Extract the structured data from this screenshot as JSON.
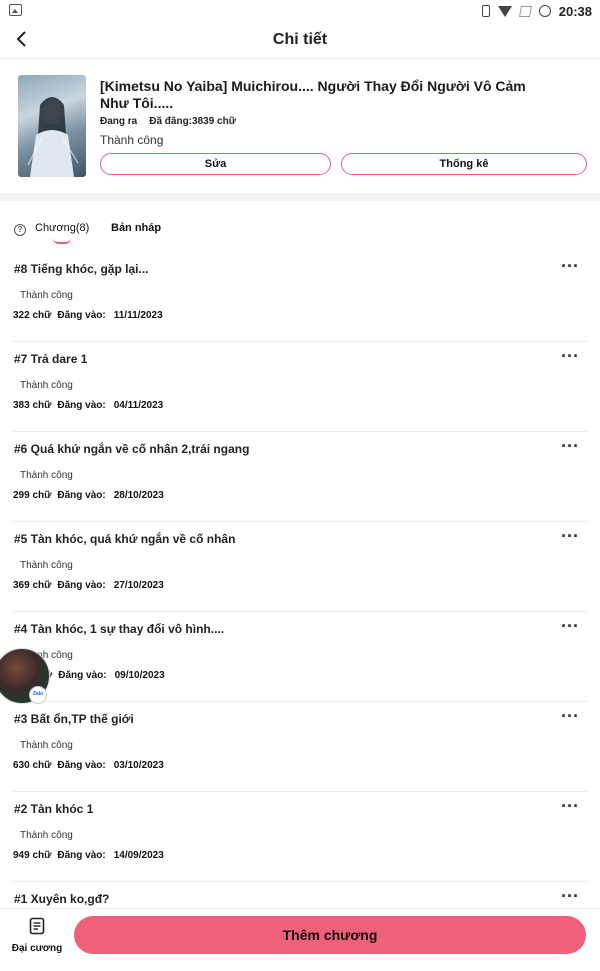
{
  "status_bar": {
    "time": "20:38"
  },
  "header": {
    "title": "Chi tiết"
  },
  "book": {
    "title": "[Kimetsu No Yaiba] Muichirou.... Người Thay Đổi Người Vô Cảm Như Tôi.....",
    "state": "Đang ra",
    "published": "Đã đăng:3839 chữ",
    "status": "Thành công",
    "edit_label": "Sửa",
    "stats_label": "Thống kê"
  },
  "tabs": {
    "chapters": "Chương(8)",
    "drafts": "Bản nháp"
  },
  "chapters": [
    {
      "title": "#8  Tiếng khóc, gặp lại...",
      "status": "Thành công",
      "words": "322 chữ",
      "posted_label": "Đăng vào:",
      "date": "11/11/2023"
    },
    {
      "title": "#7  Trả dare 1",
      "status": "Thành công",
      "words": "383 chữ",
      "posted_label": "Đăng vào:",
      "date": "04/11/2023"
    },
    {
      "title": "#6  Quá khứ ngắn về cố nhân 2,trái ngang",
      "status": "Thành công",
      "words": "299 chữ",
      "posted_label": "Đăng vào:",
      "date": "28/10/2023"
    },
    {
      "title": "#5  Tàn khóc, quá khứ ngắn về cố nhân",
      "status": "Thành công",
      "words": "369 chữ",
      "posted_label": "Đăng vào:",
      "date": "27/10/2023"
    },
    {
      "title": "#4  Tàn khóc, 1 sự thay đổi vô hình....",
      "status": "Thành công",
      "words": "ữ",
      "posted_label": "Đăng vào:",
      "date": "09/10/2023"
    },
    {
      "title": "#3  Bất ổn,TP thế giới",
      "status": "Thành công",
      "words": "630 chữ",
      "posted_label": "Đăng vào:",
      "date": "03/10/2023"
    },
    {
      "title": "#2  Tàn khóc 1",
      "status": "Thành công",
      "words": "949 chữ",
      "posted_label": "Đăng vào:",
      "date": "14/09/2023"
    },
    {
      "title": "#1  Xuyên ko,gđ?",
      "status": "",
      "words": "",
      "posted_label": "",
      "date": ""
    }
  ],
  "more_glyph": "···",
  "floating": {
    "zalo_label": "Zalo"
  },
  "bottom": {
    "outline_label": "Đại cương",
    "add_chapter_label": "Thêm chương"
  },
  "colors": {
    "accent": "#f0607a"
  },
  "icons": [
    "back-icon",
    "help-icon",
    "more-icon",
    "outline-icon"
  ]
}
